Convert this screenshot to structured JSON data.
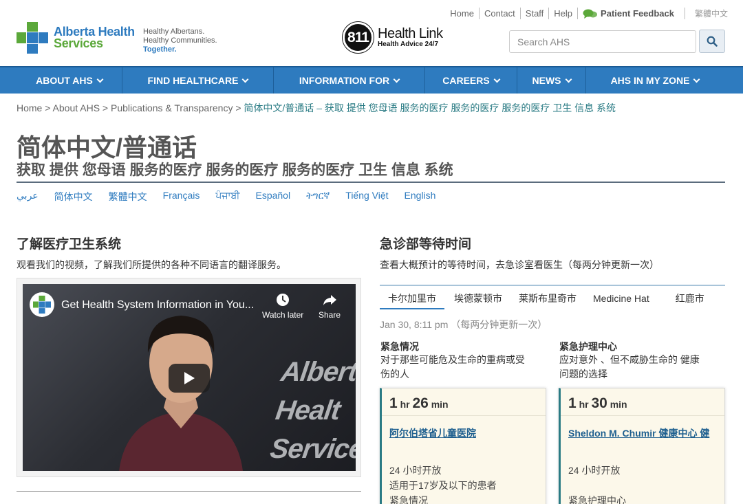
{
  "utility": {
    "links": [
      "Home",
      "Contact",
      "Staff",
      "Help"
    ],
    "feedback": "Patient Feedback",
    "traditional": "繁體中文"
  },
  "logo": {
    "line1": "Alberta Health",
    "line2": "Services"
  },
  "tagline": {
    "line1": "Healthy Albertans.",
    "line2": "Healthy Communities.",
    "line3": "Together."
  },
  "healthlink": {
    "number": "811",
    "title": "Health Link",
    "subtitle": "Health Advice 24/7"
  },
  "search": {
    "placeholder": "Search AHS"
  },
  "nav": [
    {
      "label": "ABOUT AHS"
    },
    {
      "label": "FIND HEALTHCARE"
    },
    {
      "label": "INFORMATION FOR"
    },
    {
      "label": "CAREERS"
    },
    {
      "label": "NEWS"
    },
    {
      "label": "AHS IN MY ZONE"
    }
  ],
  "breadcrumb": {
    "items": [
      "Home",
      "About AHS",
      "Publications & Transparency"
    ],
    "current": "简体中文/普通话 – 获取 提供 您母语 服务的医疗 服务的医疗 服务的医疗 卫生 信息 系统"
  },
  "page": {
    "title": "简体中文/普通话",
    "subtitle": "获取 提供 您母语 服务的医疗 服务的医疗 服务的医疗 卫生 信息 系统"
  },
  "languages": [
    "عربي",
    "简体中文",
    "繁體中文",
    "Français",
    "ਪੰਜਾਬੀ",
    "Español",
    "ትግርኛ",
    "Tiếng Việt",
    "English"
  ],
  "left": {
    "heading": "了解医疗卫生系统",
    "text": "观看我们的视频，了解我们所提供的各种不同语言的翻译服务。",
    "video": {
      "title": "Get Health System Information in You...",
      "watch_later": "Watch later",
      "share": "Share",
      "watermark1": "Alberta Healt",
      "watermark2": "Services",
      "channel1": "Alberta Health",
      "channel2": "Services"
    }
  },
  "right": {
    "heading": "急诊部等待时间",
    "text": "查看大概预计的等待时间，去急诊室看医生（每两分钟更新一次）",
    "tabs": [
      "卡尔加里市",
      "埃德蒙顿市",
      "莱斯布里奇市",
      "Medicine Hat",
      "红鹿市"
    ],
    "timestamp": "Jan 30, 8:11 pm （每两分钟更新一次）",
    "categories": [
      {
        "title": "紧急情况",
        "desc1": "对于那些可能危及生命的重病或受",
        "desc2": "伤的人"
      },
      {
        "title": "紧急护理中心",
        "desc1": "应对意外 、但不威胁生命的 健康",
        "desc2": "问题的选择"
      }
    ],
    "cards": [
      {
        "hours": "1",
        "hr": "hr",
        "mins": "26",
        "min": "min",
        "name": "阿尔伯塔省儿童医院",
        "line1": "24 小时开放",
        "line2": "适用于17岁及以下的患者",
        "line3": "紧急情况"
      },
      {
        "hours": "1",
        "hr": "hr",
        "mins": "30",
        "min": "min",
        "name": "Sheldon M. Chumir 健康中心 健",
        "line1": "24 小时开放",
        "line2": "",
        "line3": "紧急护理中心"
      }
    ]
  },
  "colors": {
    "brand_blue": "#2e7bbf",
    "brand_green": "#5ba83a",
    "teal": "#2a7b84",
    "card_bg": "#fcf8ea"
  }
}
